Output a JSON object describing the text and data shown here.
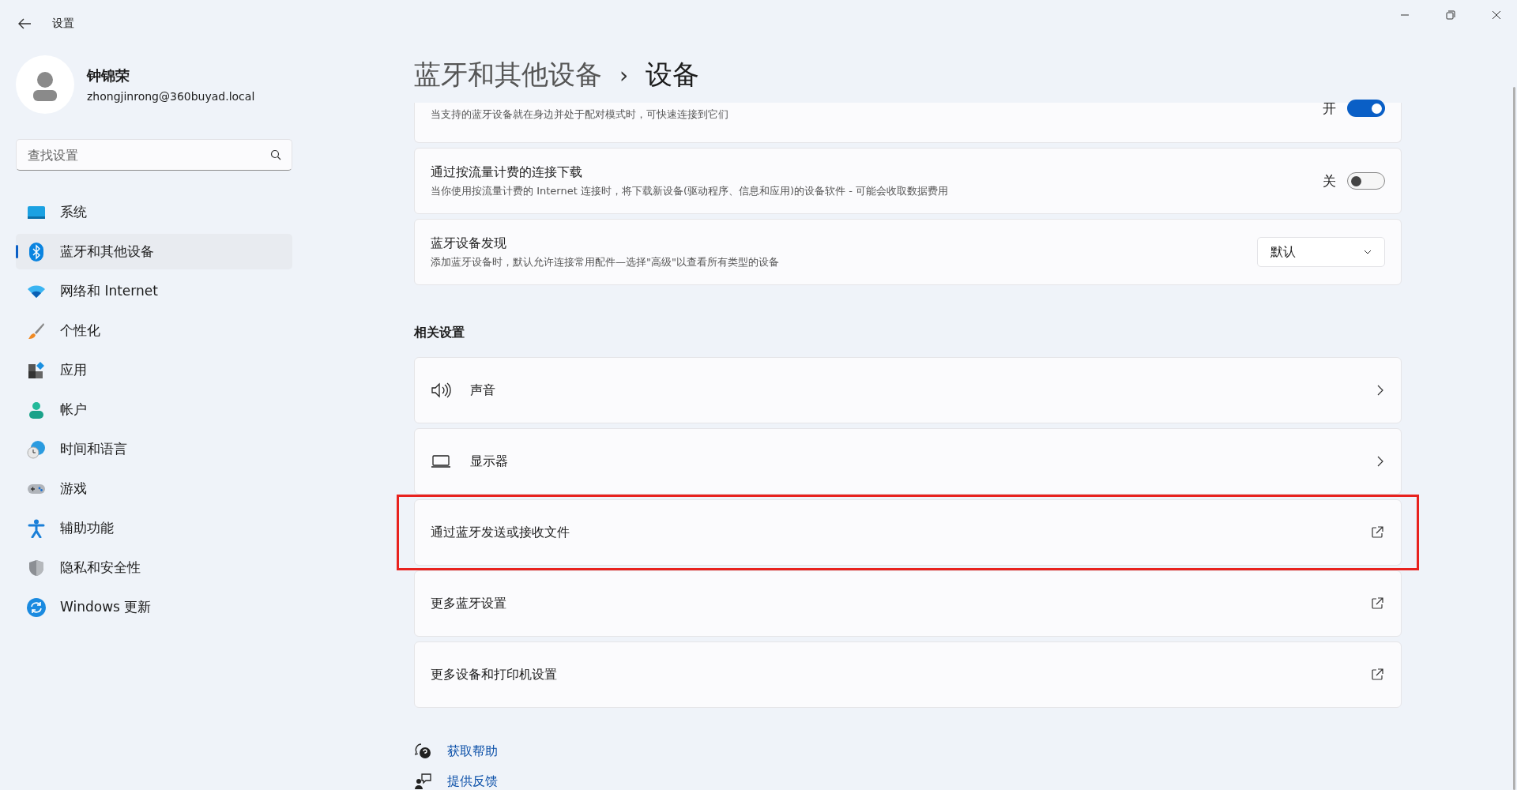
{
  "window": {
    "title": "设置"
  },
  "user": {
    "name": "钟锦荣",
    "email": "zhongjinrong@360buyad.local"
  },
  "search": {
    "placeholder": "查找设置"
  },
  "sidebar": {
    "items": [
      {
        "label": "系统",
        "selected": false
      },
      {
        "label": "蓝牙和其他设备",
        "selected": true
      },
      {
        "label": "网络和 Internet",
        "selected": false
      },
      {
        "label": "个性化",
        "selected": false
      },
      {
        "label": "应用",
        "selected": false
      },
      {
        "label": "帐户",
        "selected": false
      },
      {
        "label": "时间和语言",
        "selected": false
      },
      {
        "label": "游戏",
        "selected": false
      },
      {
        "label": "辅助功能",
        "selected": false
      },
      {
        "label": "隐私和安全性",
        "selected": false
      },
      {
        "label": "Windows 更新",
        "selected": false
      }
    ]
  },
  "breadcrumb": {
    "parent": "蓝牙和其他设备",
    "separator": "›",
    "current": "设备"
  },
  "settings": [
    {
      "kind": "toggle",
      "description": "当支持的蓝牙设备就在身边并处于配对模式时，可快速连接到它们",
      "state_label": "开",
      "on": true
    },
    {
      "kind": "toggle",
      "title": "通过按流量计费的连接下载",
      "description": "当你使用按流量计费的 Internet 连接时，将下载新设备(驱动程序、信息和应用)的设备软件 - 可能会收取数据费用",
      "state_label": "关",
      "on": false
    },
    {
      "kind": "dropdown",
      "title": "蓝牙设备发现",
      "description": "添加蓝牙设备时，默认允许连接常用配件—选择\"高级\"以查看所有类型的设备",
      "value": "默认"
    }
  ],
  "related": {
    "heading": "相关设置",
    "items": [
      {
        "label": "声音",
        "kind": "chevron",
        "highlighted": false
      },
      {
        "label": "显示器",
        "kind": "chevron",
        "highlighted": false
      },
      {
        "label": "通过蓝牙发送或接收文件",
        "kind": "external",
        "highlighted": true
      },
      {
        "label": "更多蓝牙设置",
        "kind": "external",
        "highlighted": false
      },
      {
        "label": "更多设备和打印机设置",
        "kind": "external",
        "highlighted": false
      }
    ]
  },
  "links": [
    {
      "label": "获取帮助"
    },
    {
      "label": "提供反馈"
    }
  ]
}
